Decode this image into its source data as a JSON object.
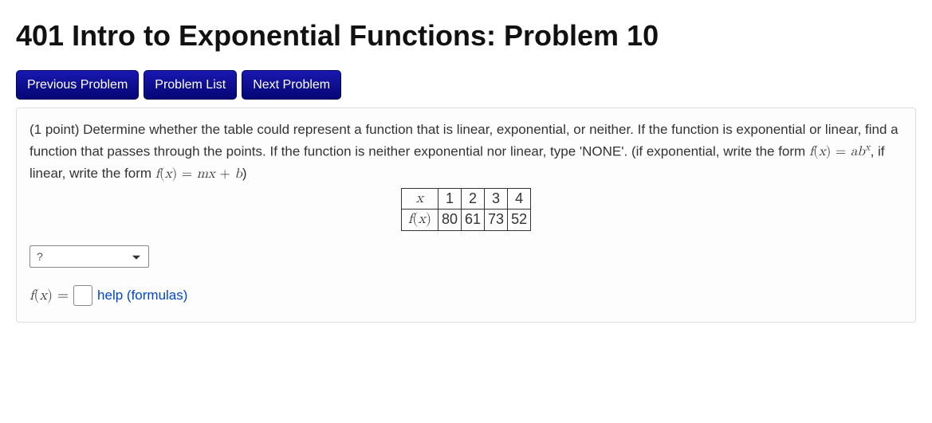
{
  "header": {
    "title": "401 Intro to Exponential Functions: Problem 10"
  },
  "nav": {
    "prev": "Previous Problem",
    "list": "Problem List",
    "next": "Next Problem"
  },
  "problem": {
    "points_prefix": "(1 point) ",
    "text_part1": "Determine whether the table could represent a function that is linear, exponential, or neither. If the function is exponential or linear, find a function that passes through the points. If the function is neither exponential nor linear, type 'NONE'. (if exponential, write the form ",
    "text_part2": ", if linear, write the form ",
    "text_part3": ")"
  },
  "chart_data": {
    "type": "table",
    "row_header_x": "x",
    "row_header_fx": "f(x)",
    "x": [
      "1",
      "2",
      "3",
      "4"
    ],
    "fx": [
      "80",
      "61",
      "73",
      "52"
    ]
  },
  "controls": {
    "type_selected": "?",
    "fx_label_f": "f",
    "fx_label_x": "x",
    "eq": "=",
    "help": "help (formulas)"
  }
}
